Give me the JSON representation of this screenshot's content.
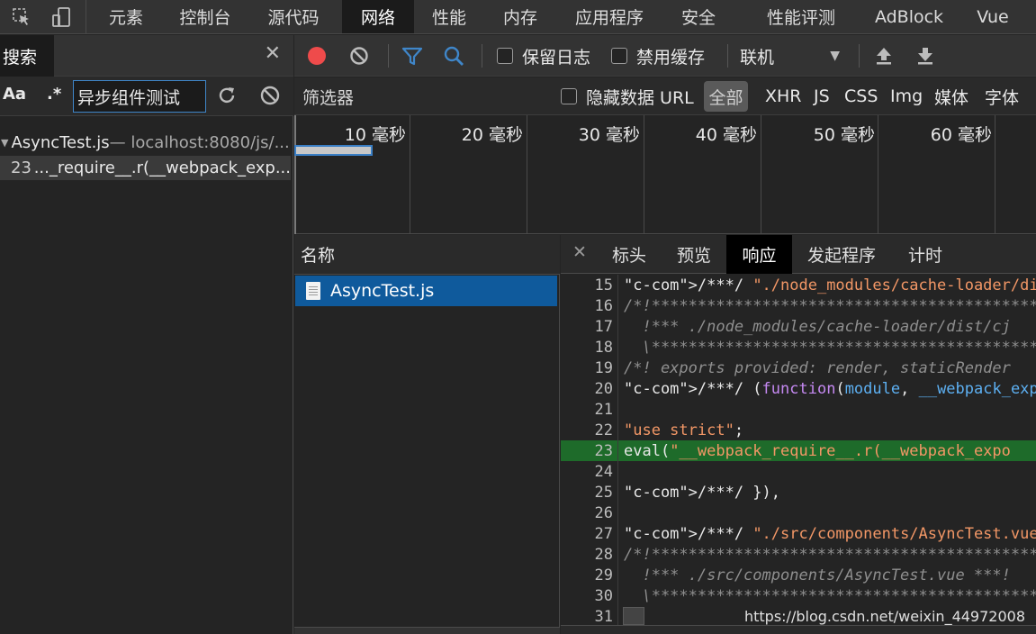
{
  "main_tabs": [
    "元素",
    "控制台",
    "源代码",
    "网络",
    "性能",
    "内存",
    "应用程序",
    "安全",
    "性能评测",
    "AdBlock",
    "Vue"
  ],
  "active_main_tab": "网络",
  "search": {
    "title": "搜索",
    "aa_label": "Aa",
    "regex_label": ".*",
    "query": "异步组件测试",
    "result_file": "AsyncTest.js",
    "result_file_sub": " — localhost:8080/js/...",
    "result_line_number": "23",
    "result_line_text": "..._require__.r(__webpack_exp..."
  },
  "network_toolbar": {
    "preserve_log": "保留日志",
    "disable_cache": "禁用缓存",
    "throttle": "联机"
  },
  "filter_bar": {
    "placeholder": "筛选器",
    "hide_data_url": "隐藏数据 URL",
    "types": [
      "全部",
      "XHR",
      "JS",
      "CSS",
      "Img",
      "媒体",
      "字体"
    ]
  },
  "overview_labels": [
    "10 毫秒",
    "20 毫秒",
    "30 毫秒",
    "40 毫秒",
    "50 毫秒",
    "60 毫秒"
  ],
  "requests": {
    "header": "名称",
    "rows": [
      "AsyncTest.js"
    ]
  },
  "detail_tabs": [
    "标头",
    "预览",
    "响应",
    "发起程序",
    "计时"
  ],
  "active_detail_tab": "响应",
  "code_lines": [
    {
      "n": "15",
      "t": "/***/ \"./node_modules/cache-loader/dist/cj"
    },
    {
      "n": "16",
      "t": "/*!**********************************************"
    },
    {
      "n": "17",
      "t": "  !*** ./node_modules/cache-loader/dist/cj"
    },
    {
      "n": "18",
      "t": "  \\**********************************************"
    },
    {
      "n": "19",
      "t": "/*! exports provided: render, staticRender"
    },
    {
      "n": "20",
      "t": "/***/ (function(module, __webpack_exports_"
    },
    {
      "n": "21",
      "t": ""
    },
    {
      "n": "22",
      "t": "\"use strict\";"
    },
    {
      "n": "23",
      "t": "eval(\"__webpack_require__.r(__webpack_expo"
    },
    {
      "n": "24",
      "t": ""
    },
    {
      "n": "25",
      "t": "/***/ }),"
    },
    {
      "n": "26",
      "t": ""
    },
    {
      "n": "27",
      "t": "/***/ \"./src/components/AsyncTest.vue\":"
    },
    {
      "n": "28",
      "t": "/*!**********************************************"
    },
    {
      "n": "29",
      "t": "  !*** ./src/components/AsyncTest.vue ***!"
    },
    {
      "n": "30",
      "t": "  \\**********************************************"
    },
    {
      "n": "31",
      "t": ""
    }
  ],
  "watermark": "https://blog.csdn.net/weixin_44972008",
  "colors": {
    "accent": "#3f86c9",
    "selected_row": "#0f5a9c",
    "highlight_line": "#1e6b2a",
    "record": "#ef4b4b"
  }
}
